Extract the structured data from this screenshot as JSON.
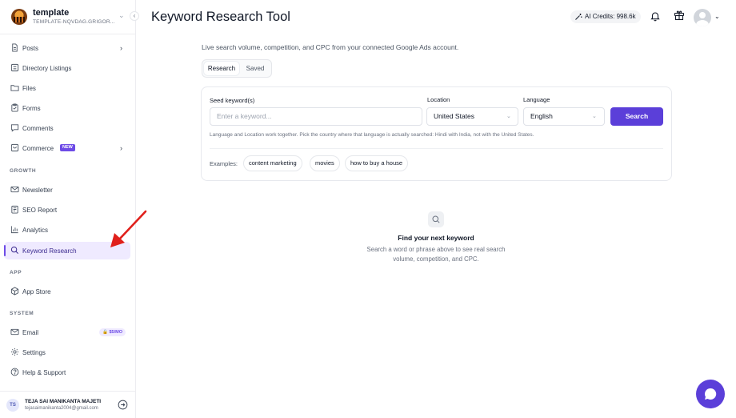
{
  "workspace": {
    "name": "template",
    "subtitle": "TEMPLATE-NQVDAG.GRIGOR..."
  },
  "sidebar": {
    "items": [
      {
        "label": "Posts",
        "icon": "document-icon",
        "has_chevron": true
      },
      {
        "label": "Directory Listings",
        "icon": "list-icon"
      },
      {
        "label": "Files",
        "icon": "folder-icon"
      },
      {
        "label": "Forms",
        "icon": "clipboard-icon"
      },
      {
        "label": "Comments",
        "icon": "comment-icon"
      },
      {
        "label": "Commerce",
        "icon": "cart-icon",
        "badge": "NEW",
        "has_chevron": true
      }
    ],
    "growth_label": "GROWTH",
    "growth_items": [
      {
        "label": "Newsletter",
        "icon": "mail-icon"
      },
      {
        "label": "SEO Report",
        "icon": "report-icon"
      },
      {
        "label": "Analytics",
        "icon": "bar-chart-icon"
      },
      {
        "label": "Keyword Research",
        "icon": "search-icon",
        "active": true
      }
    ],
    "app_label": "APP",
    "app_items": [
      {
        "label": "App Store",
        "icon": "box-icon"
      }
    ],
    "system_label": "SYSTEM",
    "system_items": [
      {
        "label": "Email",
        "icon": "mail-icon",
        "badge": "$5/MO"
      },
      {
        "label": "Settings",
        "icon": "gear-icon"
      },
      {
        "label": "Help & Support",
        "icon": "help-icon"
      }
    ]
  },
  "user": {
    "initials": "TS",
    "name": "TEJA SAI MANIKANTA MAJETI",
    "email": "tejasaimanikanta2004@gmail.com"
  },
  "header": {
    "title": "Keyword Research Tool",
    "credits": "AI Credits: 998.6k"
  },
  "main": {
    "subtitle": "Live search volume, competition, and CPC from your connected Google Ads account.",
    "tabs": [
      {
        "label": "Research",
        "active": true
      },
      {
        "label": "Saved",
        "active": false
      }
    ],
    "form": {
      "seed_label": "Seed keyword(s)",
      "seed_placeholder": "Enter a keyword...",
      "location_label": "Location",
      "location_value": "United States",
      "language_label": "Language",
      "language_value": "English",
      "search_label": "Search",
      "hint": "Language and Location work together. Pick the country where that language is actually searched: Hindi with India, not with the United States."
    },
    "examples_label": "Examples:",
    "examples": [
      "content marketing",
      "movies",
      "how to buy a house"
    ],
    "empty": {
      "title": "Find your next keyword",
      "description": "Search a word or phrase above to see real search volume, competition, and CPC."
    }
  },
  "colors": {
    "accent": "#5b3fd9",
    "active_bg": "#efeaff",
    "annotation_arrow": "#e0201b"
  }
}
